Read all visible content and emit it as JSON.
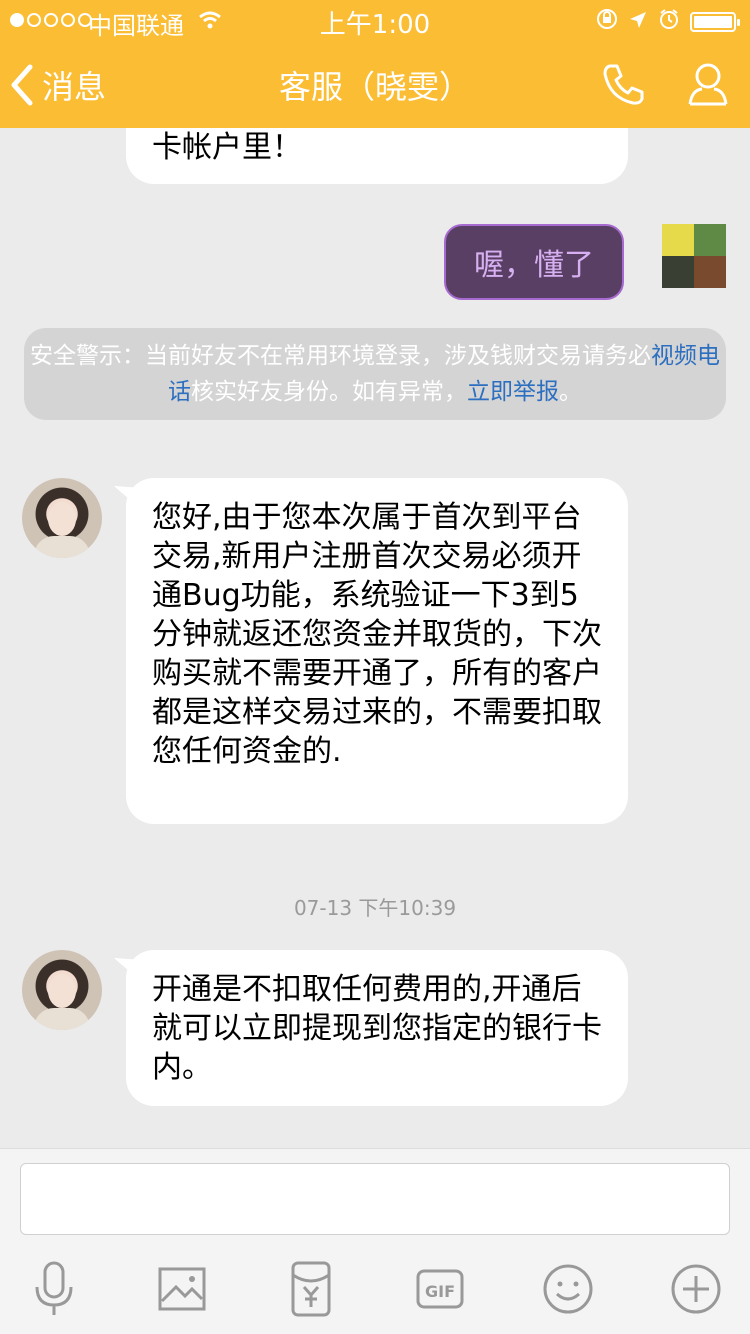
{
  "status_bar": {
    "carrier": "中国联通",
    "time": "上午1:00"
  },
  "nav": {
    "back_label": "消息",
    "title": "客服（晓雯）",
    "phone_icon": "phone-icon",
    "profile_icon": "profile-icon"
  },
  "messages": {
    "top_partial": "卡帐户里！",
    "my_reply": "喔，懂了",
    "warning": {
      "part1": "安全警示：当前好友不在常用环境登录，涉及钱财交易请务必",
      "link1": "视频电话",
      "part2": "核实好友身份。如有异常，",
      "link2": "立即举报",
      "part3": "。"
    },
    "msg1": "您好,由于您本次属于首次到平台交易,新用户注册首次交易必须开通Bug功能，系统验证一下3到5分钟就返还您资金并取货的，下次购买就不需要开通了，所有的客户都是这样交易过来的，不需要扣取您任何资金的.",
    "timestamp": "07-13 下午10:39",
    "msg2": "开通是不扣取任何费用的,开通后就可以立即提现到您指定的银行卡内。"
  },
  "input": {
    "placeholder": ""
  },
  "toolbar": {
    "icons": [
      "microphone-icon",
      "image-icon",
      "red-packet-icon",
      "gif-icon",
      "emoji-icon",
      "plus-icon"
    ]
  },
  "colors": {
    "nav_bg": "#fbbd34",
    "chat_bg": "#ebebeb",
    "link": "#2c6fc0",
    "my_bubble": "#5a3f64"
  }
}
